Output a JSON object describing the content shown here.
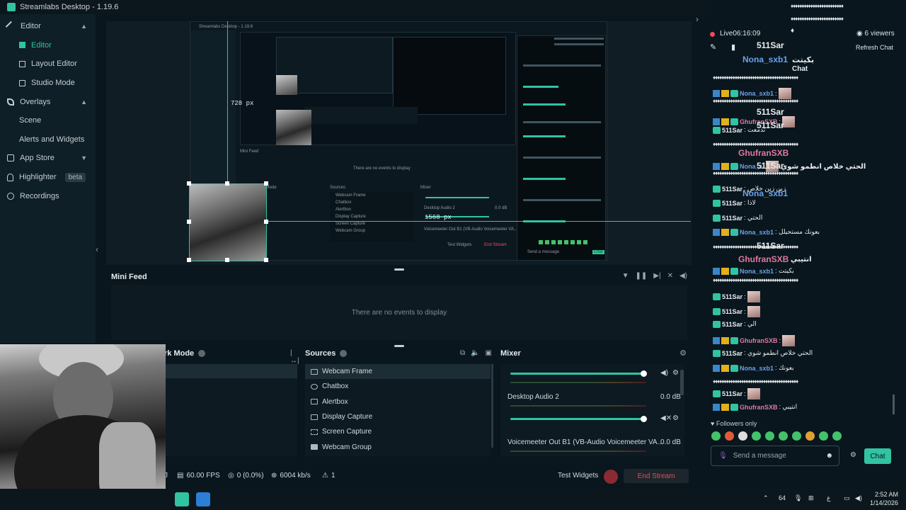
{
  "app": {
    "title": "Streamlabs Desktop - 1.19.6"
  },
  "sidebar": {
    "items": [
      {
        "label": "Editor",
        "level": 0,
        "chevron": "up",
        "icon": "pencil-icon"
      },
      {
        "label": "Editor",
        "level": 1,
        "active": true,
        "icon": "grid-icon"
      },
      {
        "label": "Layout Editor",
        "level": 1,
        "icon": "layout-icon"
      },
      {
        "label": "Studio Mode",
        "level": 1,
        "icon": "studio-icon"
      },
      {
        "label": "Overlays",
        "level": 0,
        "chevron": "up",
        "icon": "brush-icon"
      },
      {
        "label": "Scene",
        "level": 1
      },
      {
        "label": "Alerts and Widgets",
        "level": 1
      },
      {
        "label": "App Store",
        "level": 0,
        "chevron": "down",
        "icon": "store-icon"
      },
      {
        "label": "Highlighter",
        "level": 0,
        "badge": "beta",
        "icon": "lightbulb-icon"
      },
      {
        "label": "Recordings",
        "level": 0,
        "icon": "record-icon"
      }
    ]
  },
  "preview": {
    "height_label": "728 px",
    "width_label": "1568 px",
    "nested_title": "Streamlabs Desktop - 1.19.6",
    "nested_minifeed": "Mini Feed",
    "nested_no_events": "There are no events to display",
    "nested_sources": "Sources",
    "nested_mixer": "Mixer",
    "nested_workmode": "rk Mode",
    "nested_audio2": "Desktop Audio 2",
    "nested_voicemeeter": "Voicemeeter Out B1 (VB-Audio Voicemeeter VA...",
    "nested_db": "0.0 dB",
    "nested_test": "Test Widgets",
    "nested_end": "End Stream",
    "nested_chat": "Chat",
    "nested_send": "Send a message",
    "nested_sources_list": [
      "Webcam Frame",
      "Chatbox",
      "Alertbox",
      "Display Capture",
      "Screen Capture",
      "Webcam Group"
    ]
  },
  "minifeed": {
    "title": "Mini Feed",
    "empty": "There are no events to display"
  },
  "workmode": {
    "title": "rk Mode"
  },
  "sources": {
    "title": "Sources",
    "items": [
      {
        "label": "Webcam Frame",
        "icon": "image-icon",
        "selected": true
      },
      {
        "label": "Chatbox",
        "icon": "chat-icon"
      },
      {
        "label": "Alertbox",
        "icon": "alert-icon"
      },
      {
        "label": "Display Capture",
        "icon": "monitor-icon"
      },
      {
        "label": "Screen Capture",
        "icon": "screen-capture-icon"
      },
      {
        "label": "Webcam Group",
        "icon": "folder-icon"
      }
    ]
  },
  "mixer": {
    "title": "Mixer",
    "channels": [
      {
        "name": "",
        "db": "",
        "level": 0.98
      },
      {
        "name": "Desktop Audio 2",
        "db": "0.0 dB",
        "level": 0.98
      },
      {
        "name": "Voicemeeter Out B1 (VB-Audio Voicemeeter VA...",
        "db": "0.0 dB",
        "level": 0.0
      }
    ]
  },
  "footer": {
    "fps": "60.00 FPS",
    "dropped": "0 (0.0%)",
    "bitrate": "6004 kb/s",
    "alerts": "1",
    "test_widgets": "Test Widgets",
    "end_stream": "End Stream",
    "left_fragment": "J"
  },
  "chat": {
    "live_label": "Live",
    "live_time": "06:16:09",
    "viewers": "6 viewers",
    "refresh": "Refresh Chat",
    "messages": [
      {
        "user": "Nona_sxb1",
        "color": "blue",
        "text": ":"
      },
      {
        "user": "GhufranSXB",
        "color": "pink",
        "text": ":"
      },
      {
        "user": "511Sar",
        "color": "white",
        "text": ": تدمعت"
      },
      {
        "user": "Nona_s",
        "color": "blue",
        "text": ""
      },
      {
        "user": "511Sar",
        "color": "white",
        "text": ": زين زين خلاص"
      },
      {
        "user": "511Sar",
        "color": "white",
        "text": ": لاذا"
      },
      {
        "user": "511Sar",
        "color": "white",
        "text": ": الحتي"
      },
      {
        "user": "Nona_sxb1",
        "color": "blue",
        "text": ": بعونك مستحيلل"
      },
      {
        "user": "Nona_sxb1",
        "color": "blue",
        "text": ": بكيتت"
      },
      {
        "user": "511Sar",
        "color": "white",
        "text": ":"
      },
      {
        "user": "511Sar",
        "color": "white",
        "text": ":"
      },
      {
        "user": "511Sar",
        "color": "white",
        "text": ": الي"
      },
      {
        "user": "GhufranSXB",
        "color": "pink",
        "text": ":"
      },
      {
        "user": "511Sar",
        "color": "white",
        "text": ": الحتي خلاص انطمو شوي"
      },
      {
        "user": "Nona_sxb1",
        "color": "blue",
        "text": ": بعونك"
      },
      {
        "user": "511Sar",
        "color": "white",
        "text": ":"
      },
      {
        "user": "GhufranSXB",
        "color": "pink",
        "text": ": انتيبي"
      }
    ],
    "overlay": {
      "top_user": "511Sar",
      "top_word": "بكيتت",
      "second_user": "Nona_sxb1",
      "chat_word": "Chat",
      "sar_1": "511Sar",
      "sar_2": "511Sar",
      "ghufran": "GhufranSXB",
      "arabic_1": "الحتي خلاص انطمو شوي",
      "sar_3": "511Sar",
      "nona_2": "Nona_sxb1",
      "sar_4": "511Sar",
      "ghufran_2": "GhufranSXB",
      "arabic_2": "انتيبي"
    },
    "followers_only": "Followers only",
    "placeholder": "Send a message",
    "button": "Chat"
  },
  "taskbar": {
    "tray_64": "64",
    "tray_lang": "ع",
    "time": "2:52 AM",
    "date": "1/14/2026"
  },
  "colors": {
    "accent": "#31c3a2",
    "danger": "#f0495b",
    "bg": "#09161d",
    "panel": "#0f1f27"
  }
}
